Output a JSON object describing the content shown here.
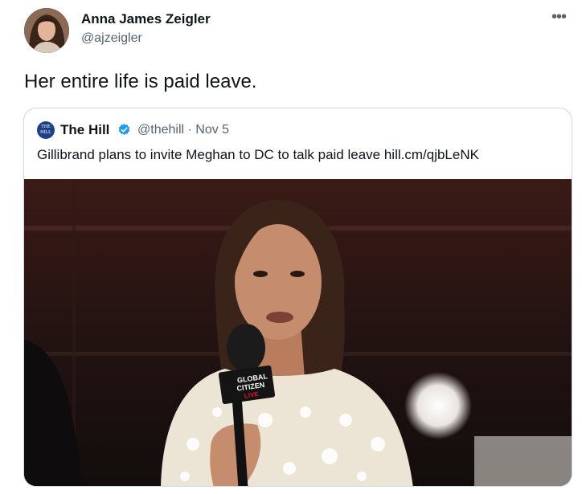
{
  "tweet": {
    "author_name": "Anna James Zeigler",
    "author_handle": "@ajzeigler",
    "more_icon": "more-horizontal-icon",
    "text": "Her entire life is paid leave."
  },
  "quoted": {
    "logo_text": "THE HILL",
    "name": "The Hill",
    "verified_icon": "verified-badge-icon",
    "verified_color": "#1d9bf0",
    "handle_date": "@thehill · Nov 5",
    "text": "Gillibrand plans to invite Meghan to DC to talk paid leave hill.cm/qjbLeNK",
    "image_mic_label_top": "GLOBAL",
    "image_mic_label_mid": "CITIZEN",
    "image_mic_label_bottom": "LIVE"
  },
  "colors": {
    "text_primary": "#0f1419",
    "text_secondary": "#536471",
    "border": "#cfd9de",
    "logo_bg": "#1e3f8a"
  }
}
